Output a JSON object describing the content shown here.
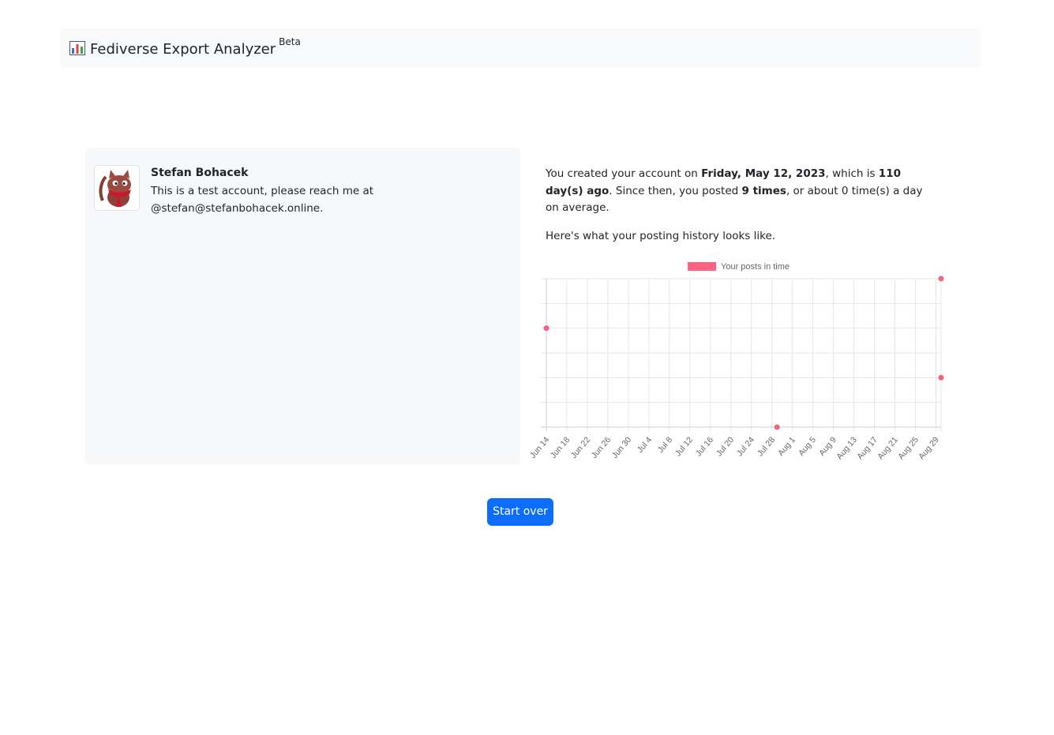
{
  "navbar": {
    "title": "Fediverse Export Analyzer",
    "badge": "Beta",
    "icon": "bar-chart-icon"
  },
  "profile": {
    "name": "Stefan Bohacek",
    "bio": "This is a test account, please reach me at @stefan@stefanbohacek.online."
  },
  "summary": {
    "intro_prefix": "You created your account on ",
    "created_date": "Friday, May 12, 2023",
    "intro_mid": ", which is ",
    "days_ago": "110 day(s) ago",
    "intro_mid2": ". Since then, you posted ",
    "post_count": "9 times",
    "intro_suffix": ", or about 0 time(s) a day on average.",
    "history_text": "Here's what your posting history looks like."
  },
  "chart_data": {
    "type": "scatter",
    "legend": "Your posts in time",
    "legend_position": "top",
    "grid": true,
    "x_tick_labels": [
      "Jun 14",
      "Jun 18",
      "Jun 22",
      "Jun 26",
      "Jun 30",
      "Jul 4",
      "Jul 8",
      "Jul 12",
      "Jul 16",
      "Jul 20",
      "Jul 24",
      "Jul 28",
      "Aug 1",
      "Aug 5",
      "Aug 9",
      "Aug 13",
      "Aug 17",
      "Aug 21",
      "Aug 25",
      "Aug 29"
    ],
    "x_range": [
      "Jun 14",
      "Aug 30"
    ],
    "points": [
      {
        "x": "Jun 14",
        "y": 4
      },
      {
        "x": "Jul 29",
        "y": 0
      },
      {
        "x": "Aug 30",
        "y": 2
      },
      {
        "x": "Aug 30",
        "y": 6
      }
    ],
    "ylim": [
      0,
      6
    ],
    "color": "#ff6384"
  },
  "actions": {
    "start_over": "Start over"
  },
  "colors": {
    "primary": "#0d6efd",
    "navbar_bg": "#f8f9fa",
    "card_bg": "#f7f8f9",
    "point": "#ff6384"
  }
}
